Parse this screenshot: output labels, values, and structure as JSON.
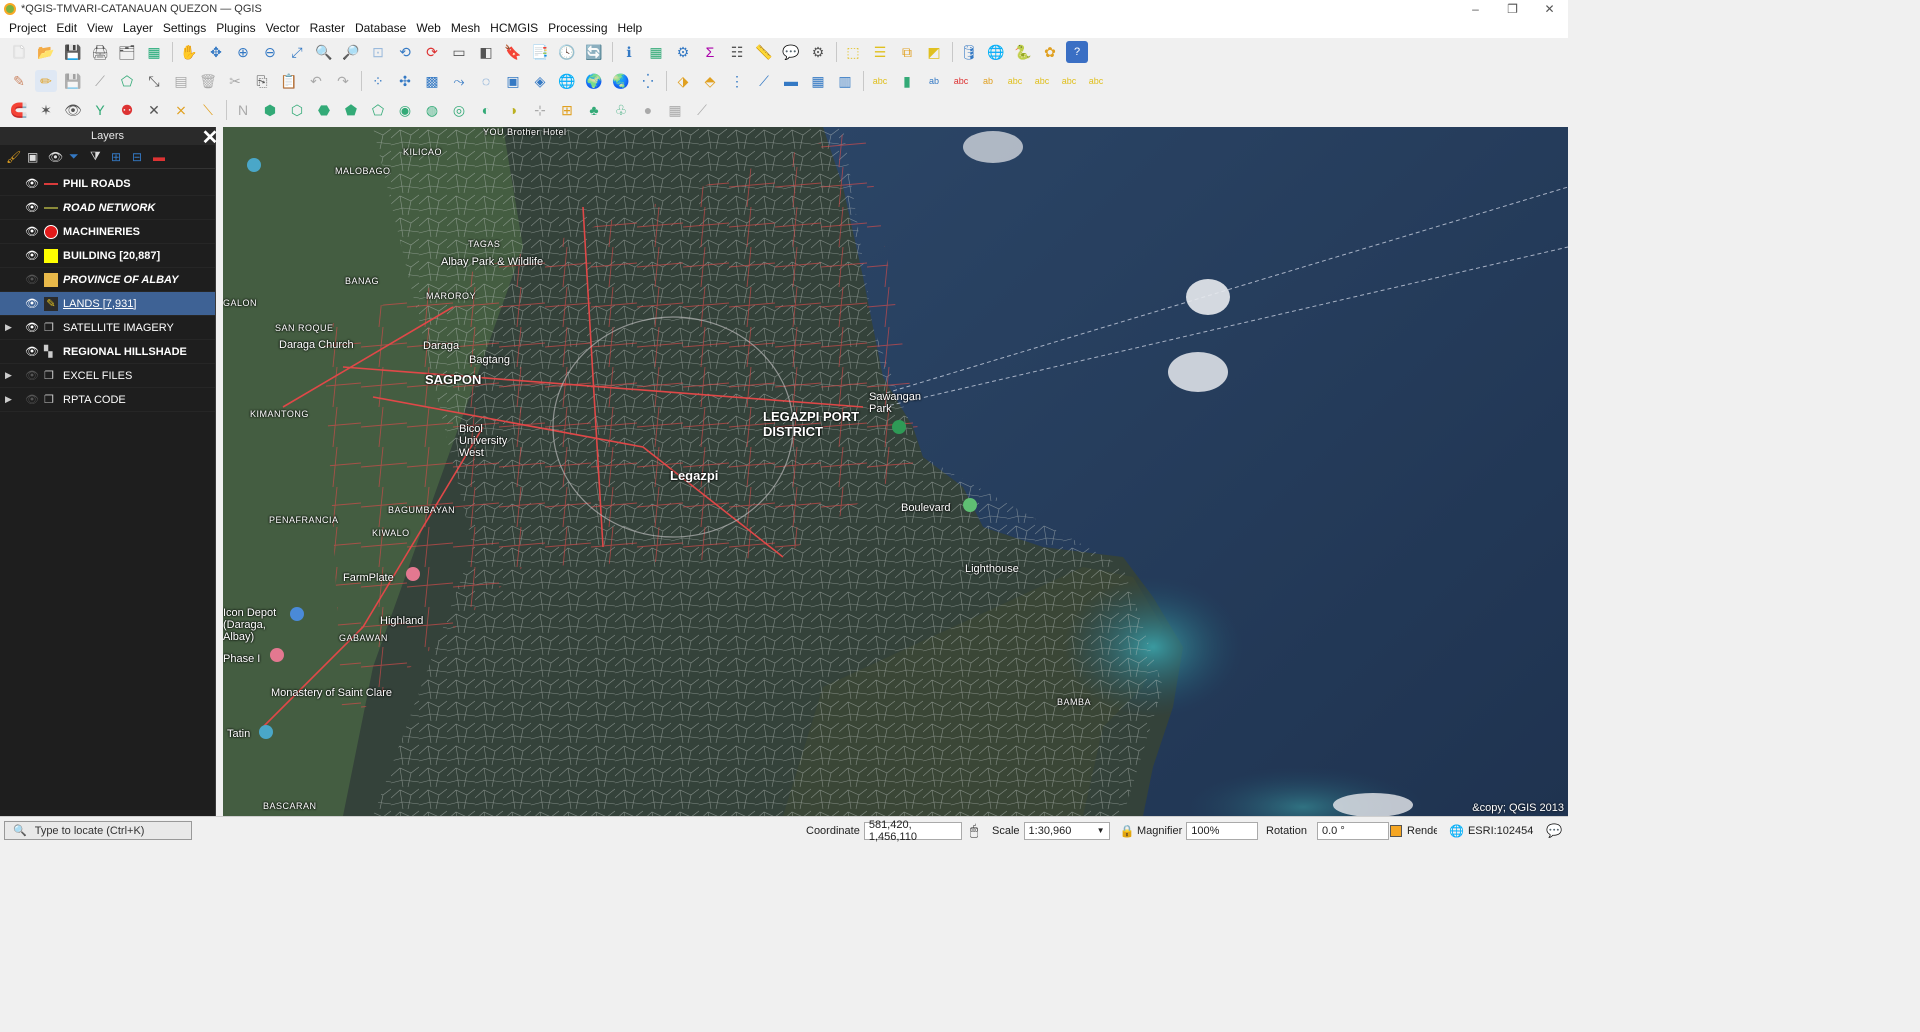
{
  "window": {
    "title": "*QGIS-TMVARI-CATANAUAN QUEZON — QGIS",
    "controls": [
      "–",
      "❐",
      "✕"
    ]
  },
  "menu": [
    "Project",
    "Edit",
    "View",
    "Layer",
    "Settings",
    "Plugins",
    "Vector",
    "Raster",
    "Database",
    "Web",
    "Mesh",
    "HCMGIS",
    "Processing",
    "Help"
  ],
  "layers_panel": {
    "title": "Layers",
    "layers": [
      {
        "name": "PHIL ROADS",
        "visible": true,
        "symbol": "line",
        "color": "#d93b3b",
        "style": "bold",
        "expandable": false,
        "selected": false
      },
      {
        "name": "ROAD NETWORK",
        "visible": true,
        "symbol": "line",
        "color": "#8a8a3a",
        "style": "bold-italic",
        "expandable": false,
        "selected": false
      },
      {
        "name": "MACHINERIES",
        "visible": true,
        "symbol": "circle",
        "color": "#e21b1b",
        "style": "bold",
        "expandable": false,
        "selected": false
      },
      {
        "name": "BUILDING [20,887]",
        "visible": true,
        "symbol": "fill",
        "color": "#ffff00",
        "style": "bold",
        "expandable": false,
        "selected": false
      },
      {
        "name": "PROVINCE OF ALBAY",
        "visible": false,
        "symbol": "fill",
        "color": "#e8b94a",
        "style": "bold-italic",
        "expandable": false,
        "selected": false
      },
      {
        "name": "LANDS [7,931]",
        "visible": true,
        "symbol": "edit",
        "color": "#ffffff",
        "style": "underline",
        "expandable": false,
        "selected": true
      },
      {
        "name": "SATELLITE IMAGERY",
        "visible": true,
        "symbol": "group",
        "color": "#cccccc",
        "style": "normal",
        "expandable": true,
        "selected": false
      },
      {
        "name": "REGIONAL HILLSHADE",
        "visible": true,
        "symbol": "raster",
        "color": "#cccccc",
        "style": "bold",
        "expandable": false,
        "selected": false
      },
      {
        "name": "EXCEL FILES",
        "visible": false,
        "symbol": "group",
        "color": "#cccccc",
        "style": "normal",
        "expandable": true,
        "selected": false
      },
      {
        "name": "RPTA CODE",
        "visible": false,
        "symbol": "group",
        "color": "#cccccc",
        "style": "normal",
        "expandable": true,
        "selected": false
      }
    ]
  },
  "map": {
    "labels": [
      {
        "text": "YOU Brother Hotel",
        "cls": "small"
      },
      {
        "text": "KILICAO",
        "cls": "small"
      },
      {
        "text": "MALOBAGO",
        "cls": "small"
      },
      {
        "text": "TAGAS",
        "cls": "small"
      },
      {
        "text": "Albay Park & Wildlife",
        "cls": ""
      },
      {
        "text": "BANAG",
        "cls": "small"
      },
      {
        "text": "MAROROY",
        "cls": "small"
      },
      {
        "text": "GALON",
        "cls": "small"
      },
      {
        "text": "SAN ROQUE",
        "cls": "small"
      },
      {
        "text": "Daraga Church",
        "cls": ""
      },
      {
        "text": "Daraga",
        "cls": ""
      },
      {
        "text": "SAGPON",
        "cls": "big"
      },
      {
        "text": "Bagtang",
        "cls": ""
      },
      {
        "text": "KIMANTONG",
        "cls": "small"
      },
      {
        "text": "Bicol University West",
        "cls": ""
      },
      {
        "text": "LEGAZPI PORT DISTRICT",
        "cls": "big"
      },
      {
        "text": "Sawangan Park",
        "cls": ""
      },
      {
        "text": "Legazpi",
        "cls": "big"
      },
      {
        "text": "BAGUMBAYAN",
        "cls": "small"
      },
      {
        "text": "Boulevard",
        "cls": ""
      },
      {
        "text": "PENAFRANCIA",
        "cls": "small"
      },
      {
        "text": "KIWALO",
        "cls": "small"
      },
      {
        "text": "FarmPlate",
        "cls": ""
      },
      {
        "text": "Lighthouse",
        "cls": ""
      },
      {
        "text": "Icon Depot (Daraga, Albay)",
        "cls": ""
      },
      {
        "text": "GABAWAN",
        "cls": "small"
      },
      {
        "text": "Highland",
        "cls": ""
      },
      {
        "text": "Phase I",
        "cls": ""
      },
      {
        "text": "Monastery of Saint Clare",
        "cls": ""
      },
      {
        "text": "Tatin",
        "cls": ""
      },
      {
        "text": "BASCARAN",
        "cls": "small"
      },
      {
        "text": "BAMBA",
        "cls": "small"
      }
    ],
    "copyright": "&copy; QGIS 2013"
  },
  "statusbar": {
    "locate_placeholder": "Type to locate (Ctrl+K)",
    "coordinate_label": "Coordinate",
    "coordinate_value": "581,420, 1,456,110",
    "scale_label": "Scale",
    "scale_value": "1:30,960",
    "magnifier_label": "Magnifier",
    "magnifier_value": "100%",
    "rotation_label": "Rotation",
    "rotation_value": "0.0 °",
    "render_label": "Render",
    "crs": "ESRI:102454"
  }
}
